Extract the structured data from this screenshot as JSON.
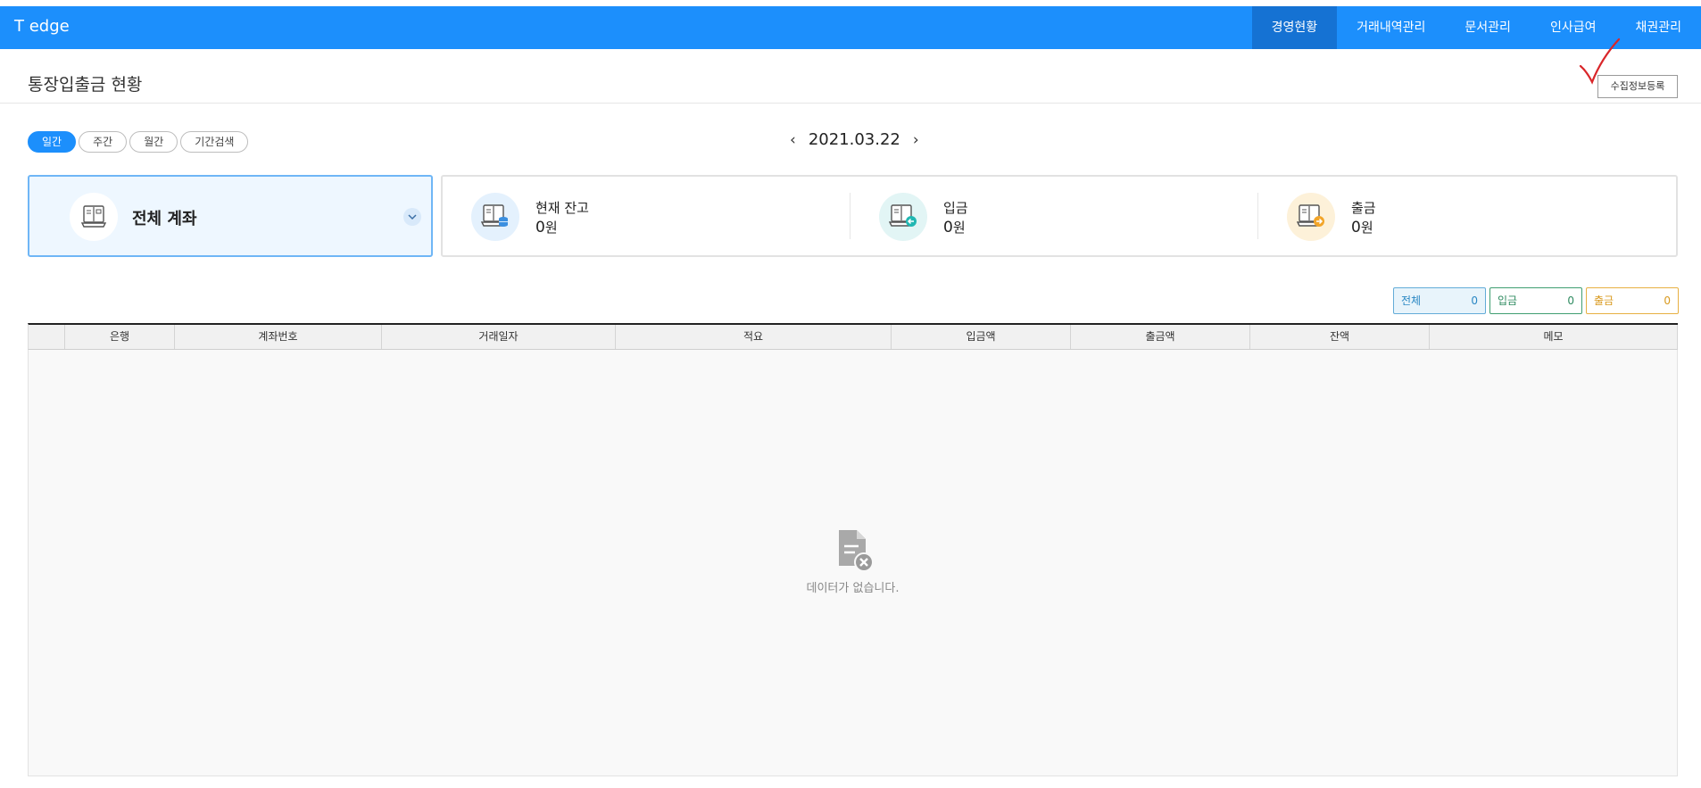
{
  "app": {
    "brand": "T edge"
  },
  "nav": {
    "items": [
      {
        "label": "경영현황",
        "active": true
      },
      {
        "label": "거래내역관리",
        "active": false
      },
      {
        "label": "문서관리",
        "active": false
      },
      {
        "label": "인사급여",
        "active": false
      },
      {
        "label": "채권관리",
        "active": false
      }
    ]
  },
  "page": {
    "title": "통장입출금 현황",
    "register_label": "수집정보등록"
  },
  "period_tabs": [
    {
      "label": "일간",
      "active": true
    },
    {
      "label": "주간",
      "active": false
    },
    {
      "label": "월간",
      "active": false
    },
    {
      "label": "기간검색",
      "active": false
    }
  ],
  "date_nav": {
    "prev": "‹",
    "date": "2021.03.22",
    "next": "›"
  },
  "account": {
    "name": "전체 계좌",
    "icon": "bankbook-icon"
  },
  "summary": {
    "balance": {
      "label": "현재 잔고",
      "value": "0",
      "unit": "원",
      "icon": "balance-icon",
      "icon_bg": "#e4f1fd"
    },
    "deposit": {
      "label": "입금",
      "value": "0",
      "unit": "원",
      "icon": "deposit-icon",
      "icon_bg": "#e2f5f5"
    },
    "withdraw": {
      "label": "출금",
      "value": "0",
      "unit": "원",
      "icon": "withdraw-icon",
      "icon_bg": "#fdf1d9"
    }
  },
  "counts": {
    "all": {
      "label": "전체",
      "value": "0"
    },
    "deposit": {
      "label": "입금",
      "value": "0"
    },
    "withdraw": {
      "label": "출금",
      "value": "0"
    }
  },
  "table": {
    "columns": [
      "",
      "은행",
      "계좌번호",
      "거래일자",
      "적요",
      "입금액",
      "출금액",
      "잔액",
      "메모"
    ],
    "rows": [],
    "empty_message": "데이터가 없습니다."
  },
  "colors": {
    "primary": "#1c8ffc",
    "nav_active": "#1572d3",
    "deposit": "#2f8b60",
    "withdraw": "#d99a1f"
  }
}
